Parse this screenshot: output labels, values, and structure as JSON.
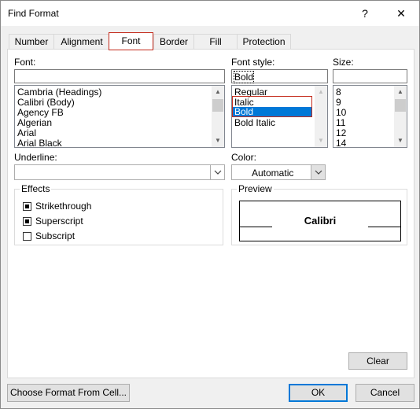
{
  "window": {
    "title": "Find Format",
    "help_label": "?",
    "close_label": "✕"
  },
  "tabs": [
    {
      "label": "Number",
      "active": false
    },
    {
      "label": "Alignment",
      "active": false
    },
    {
      "label": "Font",
      "active": true
    },
    {
      "label": "Border",
      "active": false
    },
    {
      "label": "Fill",
      "active": false
    },
    {
      "label": "Protection",
      "active": false
    }
  ],
  "font": {
    "label": "Font:",
    "input_value": "",
    "items": [
      "Cambria (Headings)",
      "Calibri (Body)",
      "Agency FB",
      "Algerian",
      "Arial",
      "Arial Black"
    ]
  },
  "font_style": {
    "label": "Font style:",
    "input_value": "Bold",
    "items": [
      "Regular",
      "Italic",
      "Bold",
      "Bold Italic"
    ],
    "selected": "Bold"
  },
  "size": {
    "label": "Size:",
    "input_value": "",
    "items": [
      "8",
      "9",
      "10",
      "11",
      "12",
      "14"
    ]
  },
  "underline": {
    "label": "Underline:",
    "value": ""
  },
  "color": {
    "label": "Color:",
    "value": "Automatic"
  },
  "effects": {
    "title": "Effects",
    "items": [
      {
        "label": "Strikethrough",
        "checked": true
      },
      {
        "label": "Superscript",
        "checked": true
      },
      {
        "label": "Subscript",
        "checked": false
      }
    ]
  },
  "preview": {
    "title": "Preview",
    "sample_text": "Calibri"
  },
  "buttons": {
    "clear": "Clear",
    "choose_format": "Choose Format From Cell...",
    "ok": "OK",
    "cancel": "Cancel"
  },
  "colors": {
    "selection": "#0078d7",
    "highlight_border": "#c42b1c"
  }
}
